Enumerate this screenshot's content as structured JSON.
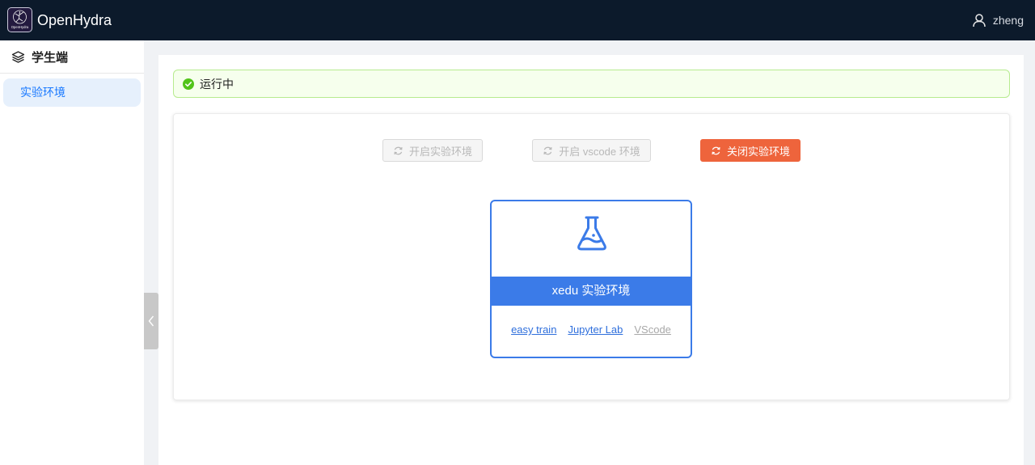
{
  "header": {
    "app_title": "OpenHydra",
    "logo_icon": "openhydra-logo",
    "logo_text": "OpenHydra",
    "user": {
      "icon": "user-icon",
      "name": "zheng"
    }
  },
  "sidebar": {
    "header": {
      "icon": "layers-icon",
      "label": "学生端"
    },
    "items": [
      {
        "label": "实验环境",
        "active": true
      }
    ],
    "collapse_icon": "chevron-left-icon"
  },
  "status": {
    "icon": "check-circle-icon",
    "text": "运行中",
    "color": "#52c41a"
  },
  "actions": {
    "start_env": {
      "icon": "sync-icon",
      "label": "开启实验环境",
      "disabled": true
    },
    "start_vscode": {
      "icon": "sync-icon",
      "label": "开启 vscode 环境",
      "disabled": true
    },
    "stop_env": {
      "icon": "sync-icon",
      "label": "关闭实验环境",
      "disabled": false
    }
  },
  "environment": {
    "icon": "flask-icon",
    "title": "xedu 实验环境",
    "links": [
      {
        "label": "easy train",
        "enabled": true
      },
      {
        "label": "Jupyter Lab",
        "enabled": true
      },
      {
        "label": "VScode",
        "enabled": false
      }
    ]
  },
  "colors": {
    "topbar": "#0c1a2b",
    "primary": "#3b7be8",
    "danger": "#ee643c",
    "success": "#52c41a"
  }
}
